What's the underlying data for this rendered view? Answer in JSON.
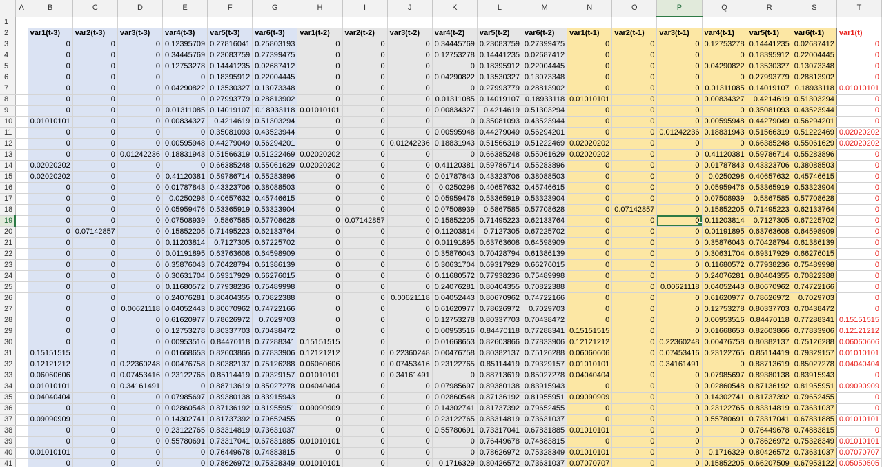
{
  "active_cell": "P19",
  "columns": [
    "A",
    "B",
    "C",
    "D",
    "E",
    "F",
    "G",
    "H",
    "I",
    "J",
    "K",
    "L",
    "M",
    "N",
    "O",
    "P",
    "Q",
    "R",
    "S",
    "T"
  ],
  "header_row": [
    "",
    "var1(t-3)",
    "var2(t-3)",
    "var3(t-3)",
    "var4(t-3)",
    "var5(t-3)",
    "var6(t-3)",
    "var1(t-2)",
    "var2(t-2)",
    "var3(t-2)",
    "var4(t-2)",
    "var5(t-2)",
    "var6(t-2)",
    "var1(t-1)",
    "var2(t-1)",
    "var3(t-1)",
    "var4(t-1)",
    "var5(t-1)",
    "var6(t-1)",
    "var1(t)"
  ],
  "rows": [
    {
      "n": "3",
      "c": [
        "0",
        "0",
        "0",
        "0.12395709",
        "0.27816041",
        "0.25803193",
        "0",
        "0",
        "0",
        "0.34445769",
        "0.23083759",
        "0.27399475",
        "0",
        "0",
        "0",
        "0.12753278",
        "0.14441235",
        "0.02687412",
        "0"
      ]
    },
    {
      "n": "4",
      "c": [
        "0",
        "0",
        "0",
        "0.34445769",
        "0.23083759",
        "0.27399475",
        "0",
        "0",
        "0",
        "0.12753278",
        "0.14441235",
        "0.02687412",
        "0",
        "0",
        "0",
        "0",
        "0.18395912",
        "0.22004445",
        "0"
      ]
    },
    {
      "n": "5",
      "c": [
        "0",
        "0",
        "0",
        "0.12753278",
        "0.14441235",
        "0.02687412",
        "0",
        "0",
        "0",
        "0",
        "0.18395912",
        "0.22004445",
        "0",
        "0",
        "0",
        "0.04290822",
        "0.13530327",
        "0.13073348",
        "0"
      ]
    },
    {
      "n": "6",
      "c": [
        "0",
        "0",
        "0",
        "0",
        "0.18395912",
        "0.22004445",
        "0",
        "0",
        "0",
        "0.04290822",
        "0.13530327",
        "0.13073348",
        "0",
        "0",
        "0",
        "0",
        "0.27993779",
        "0.28813902",
        "0"
      ]
    },
    {
      "n": "7",
      "c": [
        "0",
        "0",
        "0",
        "0.04290822",
        "0.13530327",
        "0.13073348",
        "0",
        "0",
        "0",
        "0",
        "0.27993779",
        "0.28813902",
        "0",
        "0",
        "0",
        "0.01311085",
        "0.14019107",
        "0.18933118",
        "0.01010101"
      ]
    },
    {
      "n": "8",
      "c": [
        "0",
        "0",
        "0",
        "0",
        "0.27993779",
        "0.28813902",
        "0",
        "0",
        "0",
        "0.01311085",
        "0.14019107",
        "0.18933118",
        "0.01010101",
        "0",
        "0",
        "0.00834327",
        "0.4214619",
        "0.51303294",
        "0"
      ]
    },
    {
      "n": "9",
      "c": [
        "0",
        "0",
        "0",
        "0.01311085",
        "0.14019107",
        "0.18933118",
        "0.01010101",
        "0",
        "0",
        "0.00834327",
        "0.4214619",
        "0.51303294",
        "0",
        "0",
        "0",
        "0",
        "0.35081093",
        "0.43523944",
        "0"
      ]
    },
    {
      "n": "10",
      "c": [
        "0.01010101",
        "0",
        "0",
        "0.00834327",
        "0.4214619",
        "0.51303294",
        "0",
        "0",
        "0",
        "0",
        "0.35081093",
        "0.43523944",
        "0",
        "0",
        "0",
        "0.00595948",
        "0.44279049",
        "0.56294201",
        "0"
      ]
    },
    {
      "n": "11",
      "c": [
        "0",
        "0",
        "0",
        "0",
        "0.35081093",
        "0.43523944",
        "0",
        "0",
        "0",
        "0.00595948",
        "0.44279049",
        "0.56294201",
        "0",
        "0",
        "0.01242236",
        "0.18831943",
        "0.51566319",
        "0.51222469",
        "0.02020202"
      ]
    },
    {
      "n": "12",
      "c": [
        "0",
        "0",
        "0",
        "0.00595948",
        "0.44279049",
        "0.56294201",
        "0",
        "0",
        "0.01242236",
        "0.18831943",
        "0.51566319",
        "0.51222469",
        "0.02020202",
        "0",
        "0",
        "0",
        "0.66385248",
        "0.55061629",
        "0.02020202"
      ]
    },
    {
      "n": "13",
      "c": [
        "0",
        "0",
        "0.01242236",
        "0.18831943",
        "0.51566319",
        "0.51222469",
        "0.02020202",
        "0",
        "0",
        "0",
        "0.66385248",
        "0.55061629",
        "0.02020202",
        "0",
        "0",
        "0.41120381",
        "0.59786714",
        "0.55283896",
        "0"
      ]
    },
    {
      "n": "14",
      "c": [
        "0.02020202",
        "0",
        "0",
        "0",
        "0.66385248",
        "0.55061629",
        "0.02020202",
        "0",
        "0",
        "0.41120381",
        "0.59786714",
        "0.55283896",
        "0",
        "0",
        "0",
        "0.01787843",
        "0.43323706",
        "0.38088503",
        "0"
      ]
    },
    {
      "n": "15",
      "c": [
        "0.02020202",
        "0",
        "0",
        "0.41120381",
        "0.59786714",
        "0.55283896",
        "0",
        "0",
        "0",
        "0.01787843",
        "0.43323706",
        "0.38088503",
        "0",
        "0",
        "0",
        "0.0250298",
        "0.40657632",
        "0.45746615",
        "0"
      ]
    },
    {
      "n": "16",
      "c": [
        "0",
        "0",
        "0",
        "0.01787843",
        "0.43323706",
        "0.38088503",
        "0",
        "0",
        "0",
        "0.0250298",
        "0.40657632",
        "0.45746615",
        "0",
        "0",
        "0",
        "0.05959476",
        "0.53365919",
        "0.53323904",
        "0"
      ]
    },
    {
      "n": "17",
      "c": [
        "0",
        "0",
        "0",
        "0.0250298",
        "0.40657632",
        "0.45746615",
        "0",
        "0",
        "0",
        "0.05959476",
        "0.53365919",
        "0.53323904",
        "0",
        "0",
        "0",
        "0.07508939",
        "0.5867585",
        "0.57708628",
        "0"
      ]
    },
    {
      "n": "18",
      "c": [
        "0",
        "0",
        "0",
        "0.05959476",
        "0.53365919",
        "0.53323904",
        "0",
        "0",
        "0",
        "0.07508939",
        "0.5867585",
        "0.57708628",
        "0",
        "0.07142857",
        "0",
        "0.15852205",
        "0.71495223",
        "0.62133764",
        "0"
      ]
    },
    {
      "n": "19",
      "c": [
        "0",
        "0",
        "0",
        "0.07508939",
        "0.5867585",
        "0.57708628",
        "0",
        "0.07142857",
        "0",
        "0.15852205",
        "0.71495223",
        "0.62133764",
        "0",
        "0",
        "0",
        "0.11203814",
        "0.7127305",
        "0.67225702",
        "0"
      ]
    },
    {
      "n": "20",
      "c": [
        "0",
        "0.07142857",
        "0",
        "0.15852205",
        "0.71495223",
        "0.62133764",
        "0",
        "0",
        "0",
        "0.11203814",
        "0.7127305",
        "0.67225702",
        "0",
        "0",
        "0",
        "0.01191895",
        "0.63763608",
        "0.64598909",
        "0"
      ]
    },
    {
      "n": "21",
      "c": [
        "0",
        "0",
        "0",
        "0.11203814",
        "0.7127305",
        "0.67225702",
        "0",
        "0",
        "0",
        "0.01191895",
        "0.63763608",
        "0.64598909",
        "0",
        "0",
        "0",
        "0.35876043",
        "0.70428794",
        "0.61386139",
        "0"
      ]
    },
    {
      "n": "22",
      "c": [
        "0",
        "0",
        "0",
        "0.01191895",
        "0.63763608",
        "0.64598909",
        "0",
        "0",
        "0",
        "0.35876043",
        "0.70428794",
        "0.61386139",
        "0",
        "0",
        "0",
        "0.30631704",
        "0.69317929",
        "0.66276015",
        "0"
      ]
    },
    {
      "n": "23",
      "c": [
        "0",
        "0",
        "0",
        "0.35876043",
        "0.70428794",
        "0.61386139",
        "0",
        "0",
        "0",
        "0.30631704",
        "0.69317929",
        "0.66276015",
        "0",
        "0",
        "0",
        "0.11680572",
        "0.77938236",
        "0.75489998",
        "0"
      ]
    },
    {
      "n": "24",
      "c": [
        "0",
        "0",
        "0",
        "0.30631704",
        "0.69317929",
        "0.66276015",
        "0",
        "0",
        "0",
        "0.11680572",
        "0.77938236",
        "0.75489998",
        "0",
        "0",
        "0",
        "0.24076281",
        "0.80404355",
        "0.70822388",
        "0"
      ]
    },
    {
      "n": "25",
      "c": [
        "0",
        "0",
        "0",
        "0.11680572",
        "0.77938236",
        "0.75489998",
        "0",
        "0",
        "0",
        "0.24076281",
        "0.80404355",
        "0.70822388",
        "0",
        "0",
        "0.00621118",
        "0.04052443",
        "0.80670962",
        "0.74722166",
        "0"
      ]
    },
    {
      "n": "26",
      "c": [
        "0",
        "0",
        "0",
        "0.24076281",
        "0.80404355",
        "0.70822388",
        "0",
        "0",
        "0.00621118",
        "0.04052443",
        "0.80670962",
        "0.74722166",
        "0",
        "0",
        "0",
        "0.61620977",
        "0.78626972",
        "0.7029703",
        "0"
      ]
    },
    {
      "n": "27",
      "c": [
        "0",
        "0",
        "0.00621118",
        "0.04052443",
        "0.80670962",
        "0.74722166",
        "0",
        "0",
        "0",
        "0.61620977",
        "0.78626972",
        "0.7029703",
        "0",
        "0",
        "0",
        "0.12753278",
        "0.80337703",
        "0.70438472",
        "0"
      ]
    },
    {
      "n": "28",
      "c": [
        "0",
        "0",
        "0",
        "0.61620977",
        "0.78626972",
        "0.7029703",
        "0",
        "0",
        "0",
        "0.12753278",
        "0.80337703",
        "0.70438472",
        "0",
        "0",
        "0",
        "0.00953516",
        "0.84470118",
        "0.77288341",
        "0.15151515"
      ]
    },
    {
      "n": "29",
      "c": [
        "0",
        "0",
        "0",
        "0.12753278",
        "0.80337703",
        "0.70438472",
        "0",
        "0",
        "0",
        "0.00953516",
        "0.84470118",
        "0.77288341",
        "0.15151515",
        "0",
        "0",
        "0.01668653",
        "0.82603866",
        "0.77833906",
        "0.12121212"
      ]
    },
    {
      "n": "30",
      "c": [
        "0",
        "0",
        "0",
        "0.00953516",
        "0.84470118",
        "0.77288341",
        "0.15151515",
        "0",
        "0",
        "0.01668653",
        "0.82603866",
        "0.77833906",
        "0.12121212",
        "0",
        "0.22360248",
        "0.00476758",
        "0.80382137",
        "0.75126288",
        "0.06060606"
      ]
    },
    {
      "n": "31",
      "c": [
        "0.15151515",
        "0",
        "0",
        "0.01668653",
        "0.82603866",
        "0.77833906",
        "0.12121212",
        "0",
        "0.22360248",
        "0.00476758",
        "0.80382137",
        "0.75126288",
        "0.06060606",
        "0",
        "0.07453416",
        "0.23122765",
        "0.85114419",
        "0.79329157",
        "0.01010101"
      ]
    },
    {
      "n": "32",
      "c": [
        "0.12121212",
        "0",
        "0.22360248",
        "0.00476758",
        "0.80382137",
        "0.75126288",
        "0.06060606",
        "0",
        "0.07453416",
        "0.23122765",
        "0.85114419",
        "0.79329157",
        "0.01010101",
        "0",
        "0.34161491",
        "0",
        "0.88713619",
        "0.85027278",
        "0.04040404"
      ]
    },
    {
      "n": "33",
      "c": [
        "0.06060606",
        "0",
        "0.07453416",
        "0.23122765",
        "0.85114419",
        "0.79329157",
        "0.01010101",
        "0",
        "0.34161491",
        "0",
        "0.88713619",
        "0.85027278",
        "0.04040404",
        "0",
        "0",
        "0.07985697",
        "0.89380138",
        "0.83915943",
        "0"
      ]
    },
    {
      "n": "34",
      "c": [
        "0.01010101",
        "0",
        "0.34161491",
        "0",
        "0.88713619",
        "0.85027278",
        "0.04040404",
        "0",
        "0",
        "0.07985697",
        "0.89380138",
        "0.83915943",
        "0",
        "0",
        "0",
        "0.02860548",
        "0.87136192",
        "0.81955951",
        "0.09090909"
      ]
    },
    {
      "n": "35",
      "c": [
        "0.04040404",
        "0",
        "0",
        "0.07985697",
        "0.89380138",
        "0.83915943",
        "0",
        "0",
        "0",
        "0.02860548",
        "0.87136192",
        "0.81955951",
        "0.09090909",
        "0",
        "0",
        "0.14302741",
        "0.81737392",
        "0.79652455",
        "0"
      ]
    },
    {
      "n": "36",
      "c": [
        "0",
        "0",
        "0",
        "0.02860548",
        "0.87136192",
        "0.81955951",
        "0.09090909",
        "0",
        "0",
        "0.14302741",
        "0.81737392",
        "0.79652455",
        "0",
        "0",
        "0",
        "0.23122765",
        "0.83314819",
        "0.73631037",
        "0"
      ]
    },
    {
      "n": "37",
      "c": [
        "0.09090909",
        "0",
        "0",
        "0.14302741",
        "0.81737392",
        "0.79652455",
        "0",
        "0",
        "0",
        "0.23122765",
        "0.83314819",
        "0.73631037",
        "0",
        "0",
        "0",
        "0.55780691",
        "0.73317041",
        "0.67831885",
        "0.01010101"
      ]
    },
    {
      "n": "38",
      "c": [
        "0",
        "0",
        "0",
        "0.23122765",
        "0.83314819",
        "0.73631037",
        "0",
        "0",
        "0",
        "0.55780691",
        "0.73317041",
        "0.67831885",
        "0.01010101",
        "0",
        "0",
        "0",
        "0.76449678",
        "0.74883815",
        "0"
      ]
    },
    {
      "n": "39",
      "c": [
        "0",
        "0",
        "0",
        "0.55780691",
        "0.73317041",
        "0.67831885",
        "0.01010101",
        "0",
        "0",
        "0",
        "0.76449678",
        "0.74883815",
        "0",
        "0",
        "0",
        "0",
        "0.78626972",
        "0.75328349",
        "0.01010101"
      ]
    },
    {
      "n": "40",
      "c": [
        "0.01010101",
        "0",
        "0",
        "0",
        "0.76449678",
        "0.74883815",
        "0",
        "0",
        "0",
        "0",
        "0.78626972",
        "0.75328349",
        "0.01010101",
        "0",
        "0",
        "0.1716329",
        "0.80426572",
        "0.73631037",
        "0.07070707"
      ]
    },
    {
      "n": "41",
      "c": [
        "0",
        "0",
        "0",
        "0",
        "0.78626972",
        "0.75328349",
        "0.01010101",
        "0",
        "0",
        "0.1716329",
        "0.80426572",
        "0.73631037",
        "0.07070707",
        "0",
        "0",
        "0.15852205",
        "0.66207509",
        "0.67953122",
        "0.05050505"
      ]
    }
  ]
}
